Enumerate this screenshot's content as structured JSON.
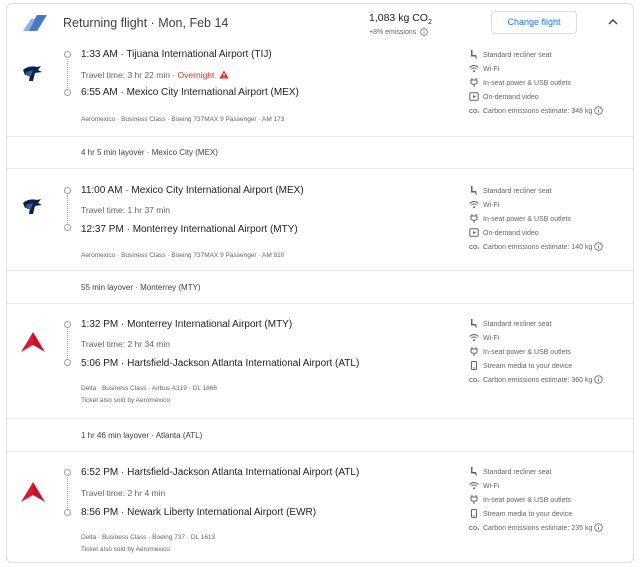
{
  "header": {
    "title": "Returning flight",
    "date": "Mon, Feb 14",
    "emissions_value": "1,083 kg CO",
    "emissions_sub": "2",
    "emissions_diff": "+8% emissions",
    "change_button": "Change flight"
  },
  "segments": [
    {
      "airline_icon": "aeromexico-logo-icon",
      "depart": "1:33 AM · Tijuana International Airport (TIJ)",
      "travel": "Travel time: 3 hr 22 min · ",
      "overnight": "Overnight",
      "arrive": "6:55 AM · Mexico City International Airport (MEX)",
      "details": "Aeromexico · Business Class · Boeing 737MAX 9 Passenger · AM 173",
      "sold_by": "",
      "amenities": [
        {
          "icon": "seat-icon",
          "label": "Standard recliner seat"
        },
        {
          "icon": "wifi-icon",
          "label": "Wi-Fi"
        },
        {
          "icon": "power-icon",
          "label": "In-seat power & USB outlets"
        },
        {
          "icon": "video-icon",
          "label": "On-demand video"
        },
        {
          "icon": "co2-icon",
          "label": "Carbon emissions estimate: 348 kg"
        }
      ]
    },
    {
      "airline_icon": "aeromexico-logo-icon",
      "depart": "11:00 AM · Mexico City International Airport (MEX)",
      "travel": "Travel time: 1 hr 37 min",
      "overnight": "",
      "arrive": "12:37 PM · Monterrey International Airport (MTY)",
      "details": "Aeromexico · Business Class · Boeing 737MAX 9 Passenger · AM 920",
      "sold_by": "",
      "amenities": [
        {
          "icon": "seat-icon",
          "label": "Standard recliner seat"
        },
        {
          "icon": "wifi-icon",
          "label": "Wi-Fi"
        },
        {
          "icon": "power-icon",
          "label": "In-seat power & USB outlets"
        },
        {
          "icon": "video-icon",
          "label": "On-demand video"
        },
        {
          "icon": "co2-icon",
          "label": "Carbon emissions estimate: 140 kg"
        }
      ]
    },
    {
      "airline_icon": "delta-logo-icon",
      "depart": "1:32 PM · Monterrey International Airport (MTY)",
      "travel": "Travel time: 2 hr 34 min",
      "overnight": "",
      "arrive": "5:06 PM · Hartsfield-Jackson Atlanta International Airport (ATL)",
      "details": "Delta · Business Class · Airbus A319 · DL 1866",
      "sold_by": "Ticket also sold by Aeromexico",
      "amenities": [
        {
          "icon": "seat-icon",
          "label": "Standard recliner seat"
        },
        {
          "icon": "wifi-icon",
          "label": "Wi-Fi"
        },
        {
          "icon": "power-icon",
          "label": "In-seat power & USB outlets"
        },
        {
          "icon": "stream-icon",
          "label": "Stream media to your device"
        },
        {
          "icon": "co2-icon",
          "label": "Carbon emissions estimate: 360 kg"
        }
      ]
    },
    {
      "airline_icon": "delta-logo-icon",
      "depart": "6:52 PM · Hartsfield-Jackson Atlanta International Airport (ATL)",
      "travel": "Travel time: 2 hr 4 min",
      "overnight": "",
      "arrive": "8:56 PM · Newark Liberty International Airport (EWR)",
      "details": "Delta · Business Class · Boeing 737 · DL 1613",
      "sold_by": "Ticket also sold by Aeromexico",
      "amenities": [
        {
          "icon": "seat-icon",
          "label": "Standard recliner seat"
        },
        {
          "icon": "wifi-icon",
          "label": "Wi-Fi"
        },
        {
          "icon": "power-icon",
          "label": "In-seat power & USB outlets"
        },
        {
          "icon": "stream-icon",
          "label": "Stream media to your device"
        },
        {
          "icon": "co2-icon",
          "label": "Carbon emissions estimate: 235 kg"
        }
      ]
    }
  ],
  "layovers": [
    "4 hr 5 min layover · Mexico City (MEX)",
    "55 min layover · Monterrey (MTY)",
    "1 hr 46 min layover · Atlanta (ATL)"
  ],
  "colors": {
    "accent": "#1a73e8",
    "warning": "#d93025",
    "aeromexico": "#0b2343",
    "delta": "#c8102e"
  }
}
